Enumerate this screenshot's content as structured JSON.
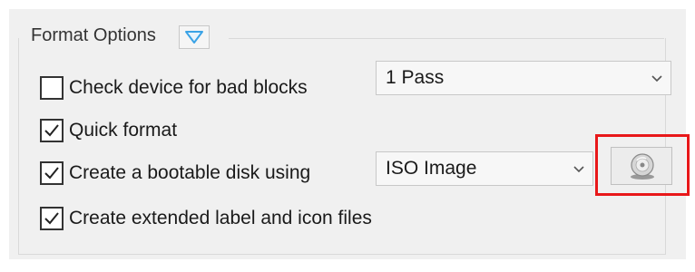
{
  "format_options": {
    "title": "Format Options",
    "toggle_icon": "chevron-down-icon"
  },
  "options": [
    {
      "label": "Check device for bad blocks",
      "checked": false
    },
    {
      "label": "Quick format",
      "checked": true
    },
    {
      "label": "Create a bootable disk using",
      "checked": true
    },
    {
      "label": "Create extended label and icon files",
      "checked": true
    }
  ],
  "bad_blocks_passes": {
    "selected": "1 Pass"
  },
  "boot_source": {
    "selected": "ISO Image"
  },
  "select_image_button": {
    "icon": "disc-icon"
  },
  "colors": {
    "highlight": "#e8181a",
    "toggle_accent": "#3ba3e6"
  }
}
